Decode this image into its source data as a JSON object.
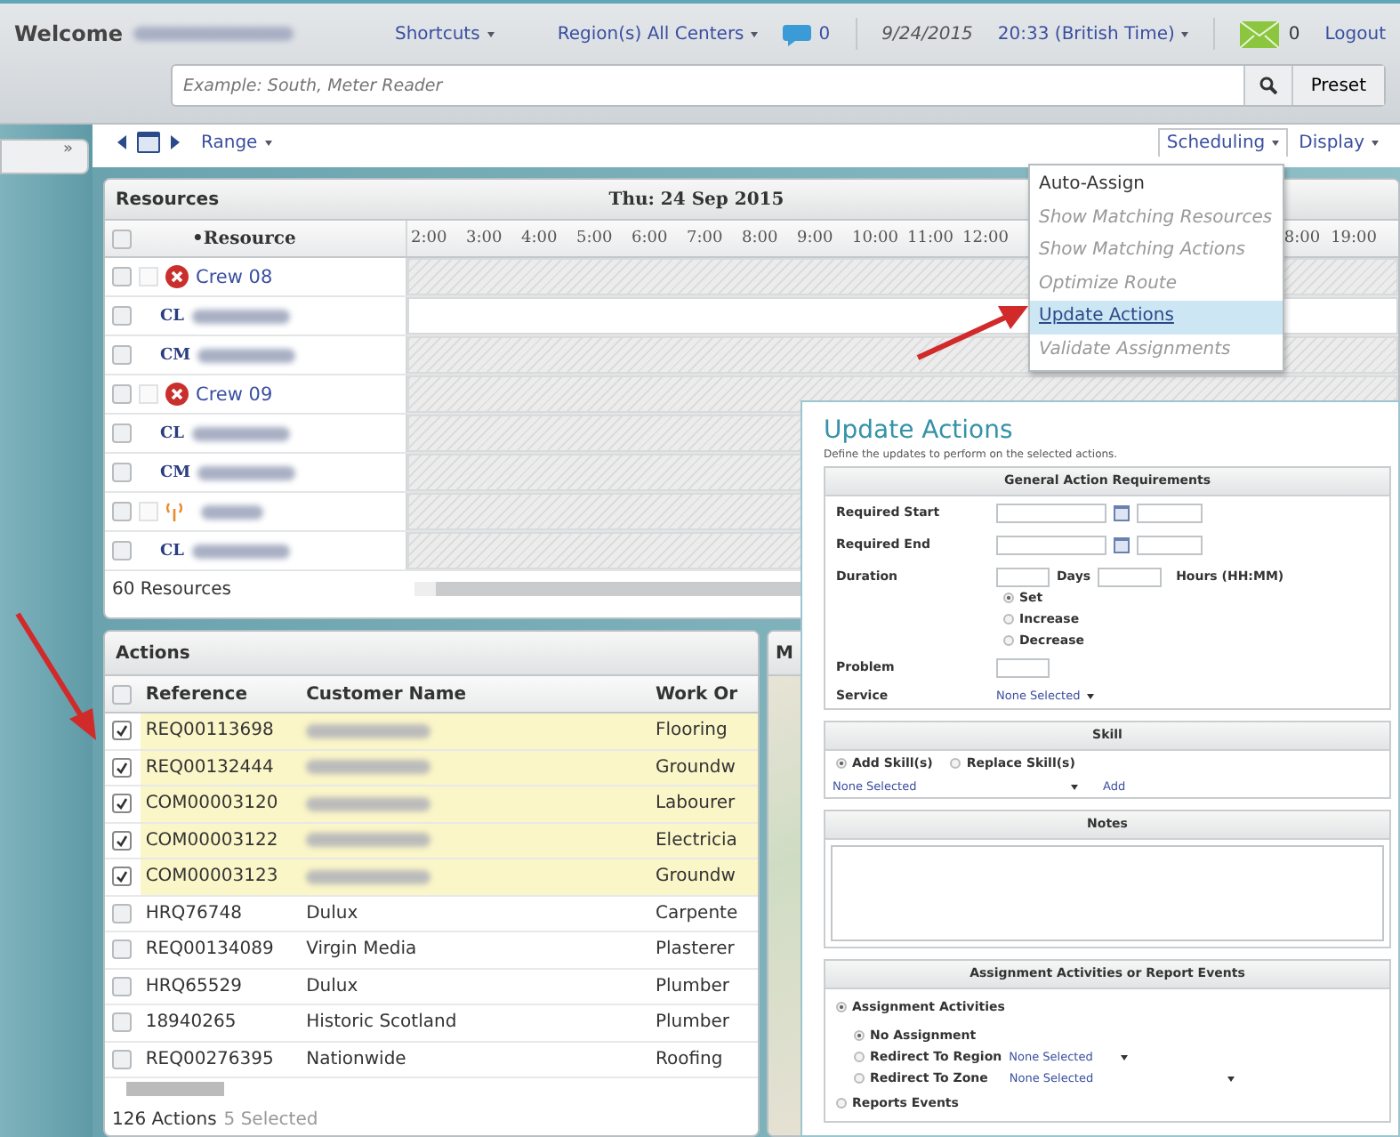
{
  "header": {
    "welcome": "Welcome",
    "shortcuts": "Shortcuts",
    "region": "Region(s) All Centers",
    "chat_count": "0",
    "date": "9/24/2015",
    "time": "20:33 (British Time)",
    "mail_count": "0",
    "logout": "Logout"
  },
  "search": {
    "placeholder": "Example: South, Meter Reader",
    "preset": "Preset"
  },
  "sidebar": {
    "toggle": "»"
  },
  "toolbar": {
    "range": "Range",
    "scheduling": "Scheduling",
    "display": "Display"
  },
  "resources": {
    "title": "Resources",
    "date": "Thu: 24 Sep 2015",
    "column": "•Resource",
    "hours_left": [
      "2:00",
      "3:00",
      "4:00",
      "5:00",
      "6:00",
      "7:00",
      "8:00",
      "9:00",
      "10:00",
      "11:00",
      "12:00"
    ],
    "hours_right": [
      "8:00",
      "19:00"
    ],
    "all_checked": false,
    "rows": [
      {
        "kind": "crew",
        "name": "Crew 08",
        "checked": false,
        "group_checked": false,
        "unavailable": true
      },
      {
        "kind": "member",
        "role": "CL",
        "checked": false,
        "unavailable": false
      },
      {
        "kind": "member",
        "role": "CM",
        "checked": false,
        "unavailable": true
      },
      {
        "kind": "crew",
        "name": "Crew 09",
        "checked": false,
        "group_checked": false,
        "unavailable": true
      },
      {
        "kind": "member",
        "role": "CL",
        "checked": false,
        "unavailable": true
      },
      {
        "kind": "member",
        "role": "CM",
        "checked": false,
        "unavailable": true
      },
      {
        "kind": "device",
        "checked": false,
        "group_checked": false,
        "unavailable": true
      },
      {
        "kind": "member",
        "role": "CL",
        "checked": false,
        "unavailable": true
      }
    ],
    "footer": "60 Resources"
  },
  "scheduling_menu": {
    "items": [
      {
        "label": "Auto-Assign",
        "disabled": false,
        "selected": false
      },
      {
        "label": "Show Matching Resources",
        "disabled": true,
        "selected": false
      },
      {
        "label": "Show Matching Actions",
        "disabled": true,
        "selected": false
      },
      {
        "label": "Optimize Route",
        "disabled": true,
        "selected": false
      },
      {
        "label": "Update Actions",
        "disabled": false,
        "selected": true
      },
      {
        "label": "Validate Assignments",
        "disabled": true,
        "selected": false
      }
    ]
  },
  "actions": {
    "title": "Actions",
    "all_checked": false,
    "columns": [
      "Reference",
      "Customer Name",
      "Work Or"
    ],
    "rows": [
      {
        "checked": true,
        "reference": "REQ00113698",
        "work": "Flooring"
      },
      {
        "checked": true,
        "reference": "REQ00132444",
        "work": "Groundw"
      },
      {
        "checked": true,
        "reference": "COM00003120",
        "work": "Labourer"
      },
      {
        "checked": true,
        "reference": "COM00003122",
        "work": "Electricia"
      },
      {
        "checked": true,
        "reference": "COM00003123",
        "work": "Groundw"
      },
      {
        "checked": false,
        "reference": "HRQ76748",
        "customer": "Dulux",
        "work": "Carpente"
      },
      {
        "checked": false,
        "reference": "REQ00134089",
        "customer": "Virgin Media",
        "work": "Plasterer"
      },
      {
        "checked": false,
        "reference": "HRQ65529",
        "customer": "Dulux",
        "work": "Plumber"
      },
      {
        "checked": false,
        "reference": "18940265",
        "customer": "Historic Scotland",
        "work": "Plumber"
      },
      {
        "checked": false,
        "reference": "REQ00276395",
        "customer": "Nationwide",
        "work": "Roofing"
      }
    ],
    "count": "126 Actions",
    "selected_count": "5 Selected"
  },
  "map": {
    "title": "M"
  },
  "dialog": {
    "title": "Update Actions",
    "subtitle": "Define the updates to perform on the selected actions.",
    "general": {
      "header": "General Action Requirements",
      "required_start": "Required Start",
      "required_end": "Required End",
      "duration": "Duration",
      "days": "Days",
      "hours": "Hours (HH:MM)",
      "modes": [
        {
          "label": "Set",
          "selected": true
        },
        {
          "label": "Increase",
          "selected": false
        },
        {
          "label": "Decrease",
          "selected": false
        }
      ],
      "problem": "Problem",
      "service": "Service",
      "service_value": "None Selected"
    },
    "skill": {
      "header": "Skill",
      "modes": [
        {
          "label": "Add Skill(s)",
          "selected": true
        },
        {
          "label": "Replace Skill(s)",
          "selected": false
        }
      ],
      "value": "None Selected",
      "add": "Add"
    },
    "notes": {
      "header": "Notes"
    },
    "assignment": {
      "header": "Assignment Activities or Report Events",
      "top": [
        {
          "label": "Assignment Activities",
          "selected": true
        },
        {
          "label": "Reports Events",
          "selected": false
        }
      ],
      "options": [
        {
          "label": "No Assignment",
          "selected": true
        },
        {
          "label": "Redirect To Region",
          "selected": false,
          "value": "None Selected"
        },
        {
          "label": "Redirect To Zone",
          "selected": false,
          "value": "None Selected"
        }
      ]
    }
  }
}
